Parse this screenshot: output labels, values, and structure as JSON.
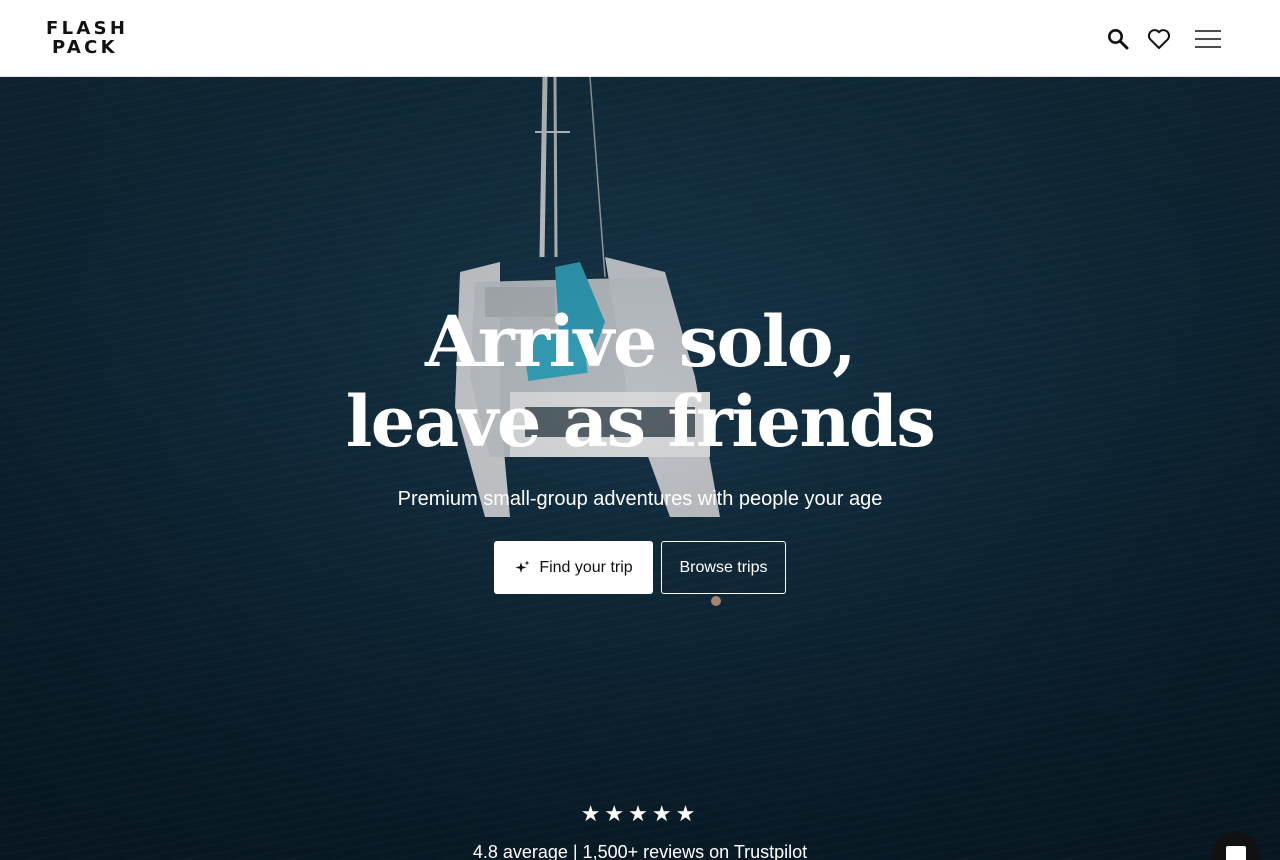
{
  "header": {
    "logo_line1": "FLASH",
    "logo_line2": "PACK",
    "icons": [
      "search-icon",
      "heart-icon",
      "hamburger-menu-icon"
    ]
  },
  "hero": {
    "headline_line1": "Arrive solo,",
    "headline_line2": "leave as friends",
    "subtitle": "Premium small-group adventures with people your age",
    "primary_button": "Find your trip",
    "primary_button_icon": "sparkle-icon",
    "secondary_button": "Browse trips",
    "stars": "★★★★★",
    "star_count": 5,
    "rating_text": "4.8 average | 1,500+ reviews on Trustpilot"
  },
  "chat": {
    "icon": "chat-icon"
  },
  "colors": {
    "header_bg": "#ffffff",
    "text_dark": "#111111",
    "water": "#183c52",
    "white": "#ffffff"
  }
}
